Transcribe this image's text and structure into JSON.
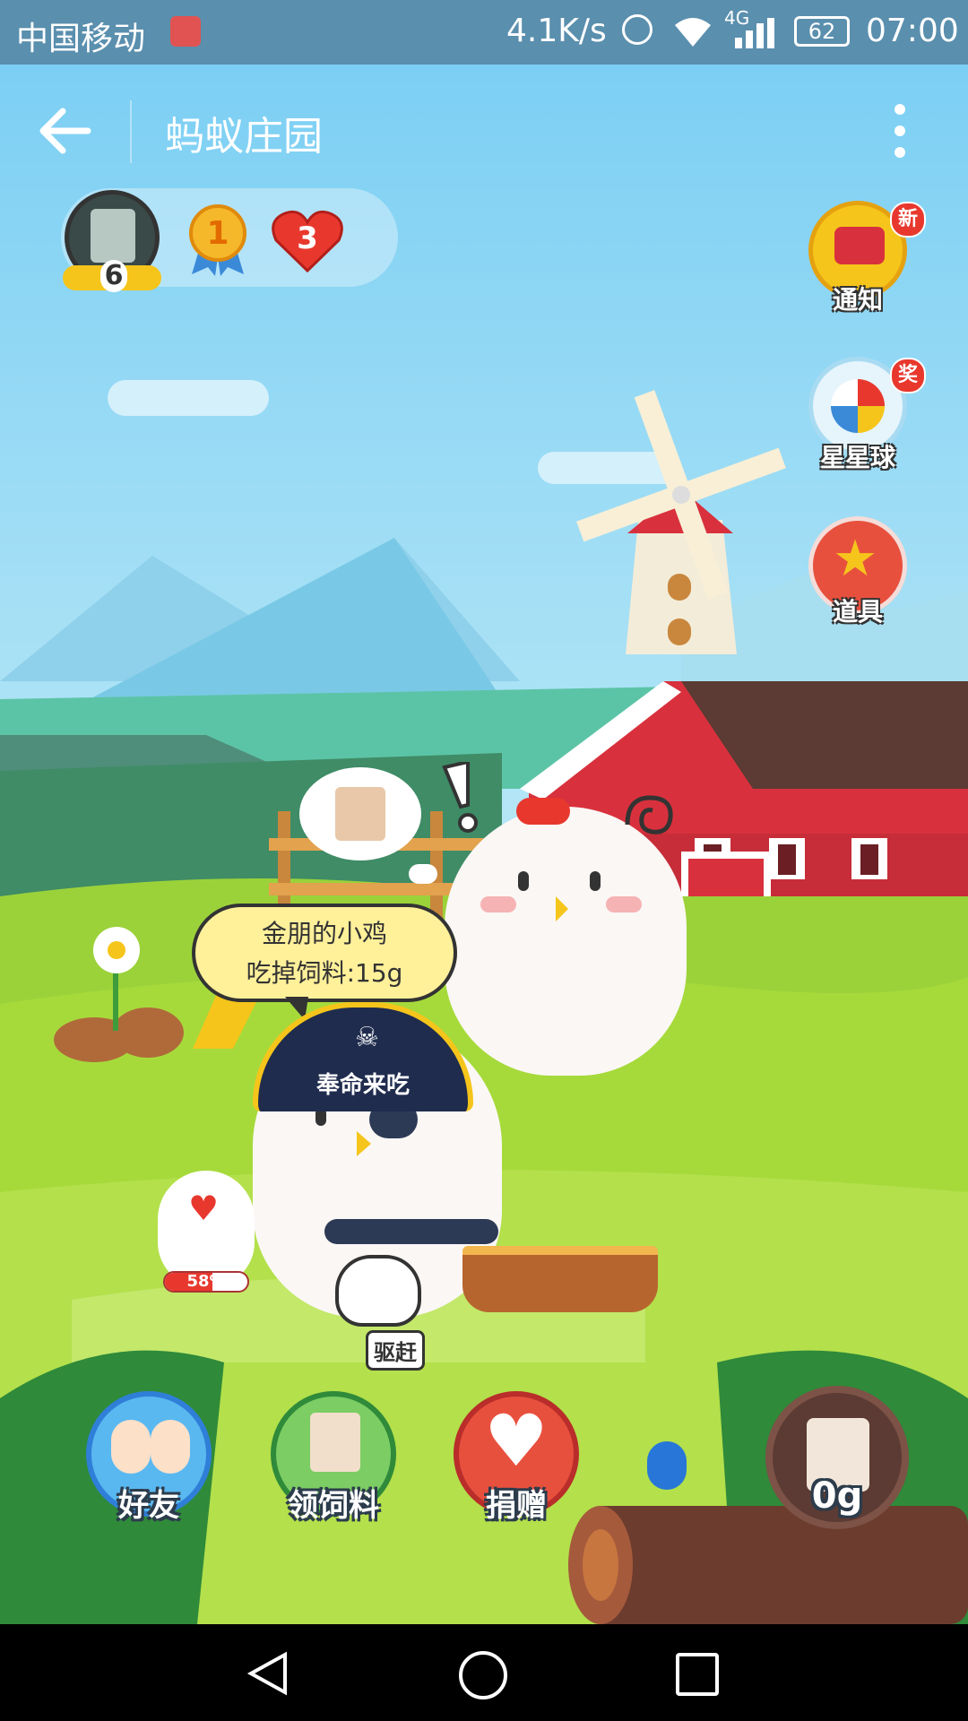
{
  "status_bar": {
    "carrier": "中国移动",
    "speed": "4.1K/s",
    "network": "4G",
    "battery": "62",
    "time": "07:00"
  },
  "header": {
    "title": "蚂蚁庄园"
  },
  "profile": {
    "level": "6",
    "medal": "1",
    "hearts": "3"
  },
  "side_buttons": [
    {
      "label": "通知",
      "badge": "新"
    },
    {
      "label": "星星球",
      "badge": "奖"
    },
    {
      "label": "道具",
      "badge": ""
    }
  ],
  "scene": {
    "speech_bubble_line1": "金朋的小鸡",
    "speech_bubble_line2": "吃掉饲料:15g",
    "pirate_hat_text": "奉命来吃",
    "drive_away_label": "驱赶",
    "egg_progress": "58%",
    "egg_progress_value": 0.58
  },
  "bottom_bar": {
    "friends": "好友",
    "get_feed": "领饲料",
    "donate": "捐赠",
    "feed_amount": "0g"
  },
  "colors": {
    "status_bar": "#5a8fae",
    "sky": "#7fcff2",
    "grass": "#8fd13a",
    "barn_red": "#d8313d",
    "accent_yellow": "#f5c51b"
  }
}
